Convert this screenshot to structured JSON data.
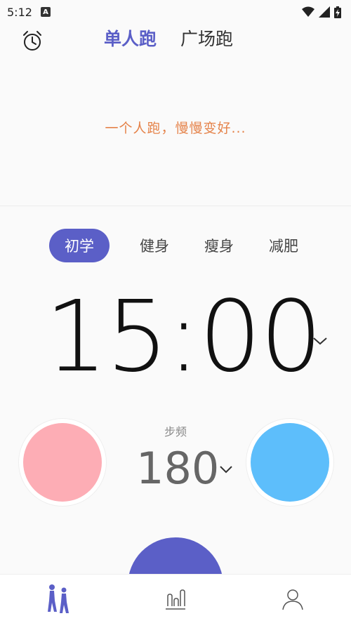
{
  "status_bar": {
    "time": "5:12",
    "notification_icon": "A"
  },
  "header": {
    "tabs": [
      {
        "label": "单人跑",
        "active": true
      },
      {
        "label": "广场跑",
        "active": false
      }
    ]
  },
  "slogan": "一个人跑，慢慢变好...",
  "modes": [
    {
      "label": "初学",
      "active": true
    },
    {
      "label": "健身",
      "active": false
    },
    {
      "label": "瘦身",
      "active": false
    },
    {
      "label": "减肥",
      "active": false
    }
  ],
  "timer": {
    "value": "15:00"
  },
  "cadence": {
    "label": "步频",
    "value": "180"
  },
  "colors": {
    "accent": "#5b5fc7",
    "slogan": "#e5834a",
    "left_circle": "#fdadb5",
    "right_circle": "#5dbefb"
  },
  "bottom_nav": {
    "items": [
      {
        "icon": "runners-icon",
        "active": true
      },
      {
        "icon": "stats-icon",
        "active": false
      },
      {
        "icon": "profile-icon",
        "active": false
      }
    ]
  }
}
